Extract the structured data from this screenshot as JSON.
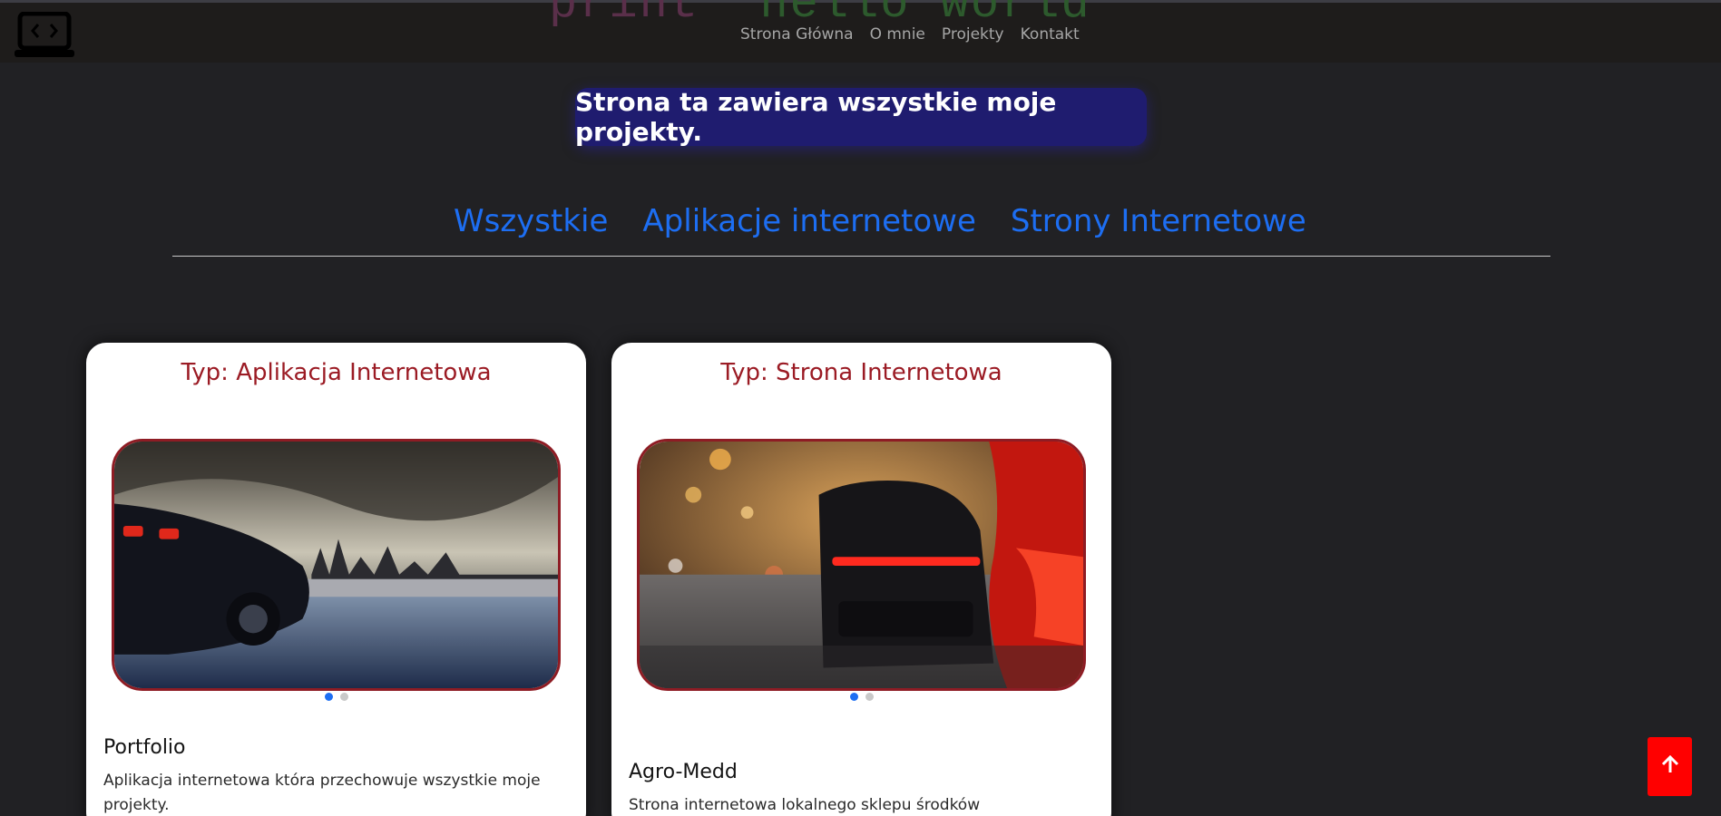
{
  "header": {
    "banner": {
      "keyword": "print",
      "string": "\"hello world\""
    },
    "nav": [
      "Strona Główna",
      "O mnie",
      "Projekty",
      "Kontakt"
    ]
  },
  "intro": {
    "text": "Strona ta zawiera wszystkie moje projekty."
  },
  "filters": [
    "Wszystkie",
    "Aplikacje internetowe",
    "Strony Internetowe"
  ],
  "cards": [
    {
      "type": "Typ: Aplikacja Internetowa",
      "title": "Portfolio",
      "description": "Aplikacja internetowa która przechowuje wszystkie moje projekty.",
      "slides": 2,
      "active_slide": 1
    },
    {
      "type": "Typ: Strona Internetowa",
      "title": "Agro-Medd",
      "description": "Strona internetowa lokalnego sklepu środków chemicznych",
      "slides": 2,
      "active_slide": 1
    }
  ],
  "colors": {
    "accent": "#1d6ef2",
    "type_label": "#9b1b24",
    "intro_bg": "#1f1c6f",
    "back_to_top": "#ff0000"
  },
  "icons": {
    "logo": "code-laptop-icon",
    "back_to_top": "arrow-up-icon"
  }
}
